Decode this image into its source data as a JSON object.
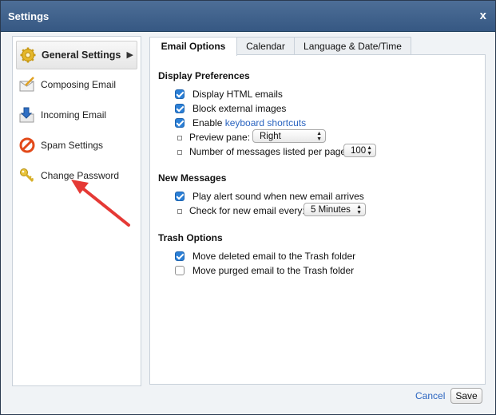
{
  "dialog": {
    "title": "Settings",
    "close_label": "x"
  },
  "sidebar": {
    "items": [
      {
        "label": "General Settings",
        "icon": "gear-icon",
        "active": true
      },
      {
        "label": "Composing Email",
        "icon": "envelope-compose-icon"
      },
      {
        "label": "Incoming Email",
        "icon": "download-arrow-icon"
      },
      {
        "label": "Spam Settings",
        "icon": "no-entry-icon"
      },
      {
        "label": "Change Password",
        "icon": "key-icon"
      }
    ]
  },
  "tabs": [
    {
      "label": "Email Options",
      "active": true
    },
    {
      "label": "Calendar"
    },
    {
      "label": "Language & Date/Time"
    }
  ],
  "sections": {
    "display": {
      "title": "Display Preferences",
      "display_html": {
        "label": "Display HTML emails",
        "checked": true
      },
      "block_images": {
        "label": "Block external images",
        "checked": true
      },
      "keyboard_shortcuts": {
        "label_prefix": "Enable ",
        "link": "keyboard shortcuts",
        "checked": true
      },
      "preview_pane": {
        "label": "Preview pane:",
        "value": "Right"
      },
      "messages_per_page": {
        "label": "Number of messages listed per page:",
        "value": "100"
      }
    },
    "new_messages": {
      "title": "New Messages",
      "alert_sound": {
        "label": "Play alert sound when new email arrives",
        "checked": true
      },
      "check_interval": {
        "label": "Check for new email every:",
        "value": "5 Minutes"
      }
    },
    "trash": {
      "title": "Trash Options",
      "move_deleted": {
        "label": "Move deleted email to the Trash folder",
        "checked": true
      },
      "move_purged": {
        "label": "Move purged email to the Trash folder",
        "checked": false
      }
    }
  },
  "footer": {
    "cancel_label": "Cancel",
    "save_label": "Save"
  },
  "colors": {
    "titlebar": "#3f628d",
    "checkbox": "#2b7fd6",
    "link": "#2a64c0",
    "annotation_arrow": "#e53935"
  }
}
